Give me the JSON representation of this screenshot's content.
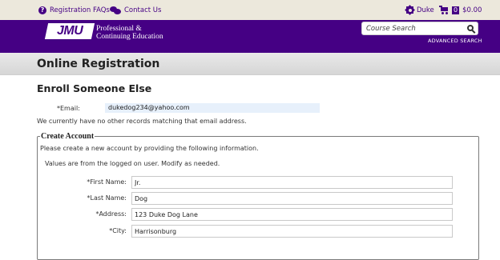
{
  "topbar": {
    "faq_label": "Registration FAQs",
    "contact_label": "Contact Us",
    "user_label": "Duke",
    "cart_count": "0",
    "cart_total": "$0.00"
  },
  "header": {
    "logo_text": "JMU",
    "org_line1": "Professional &",
    "org_line2": "Continuing Education",
    "search_placeholder": "Course Search",
    "advanced_search": "ADVANCED SEARCH",
    "brand_color": "#450084"
  },
  "page": {
    "title": "Online Registration",
    "subtitle": "Enroll Someone Else",
    "email_label": "*Email:",
    "email_value": "dukedog234@yahoo.com",
    "note": "We currently have no other records matching that email address."
  },
  "create_account": {
    "legend": "Create Account",
    "instruction": "Please create a new account by providing the following information.",
    "sub_instruction": "Values are from the logged on user. Modify as needed.",
    "fields": [
      {
        "label": "*First Name:",
        "value": "Jr."
      },
      {
        "label": "*Last Name:",
        "value": "Dog"
      },
      {
        "label": "*Address:",
        "value": "123 Duke Dog Lane"
      },
      {
        "label": "*City:",
        "value": "Harrisonburg"
      }
    ]
  }
}
